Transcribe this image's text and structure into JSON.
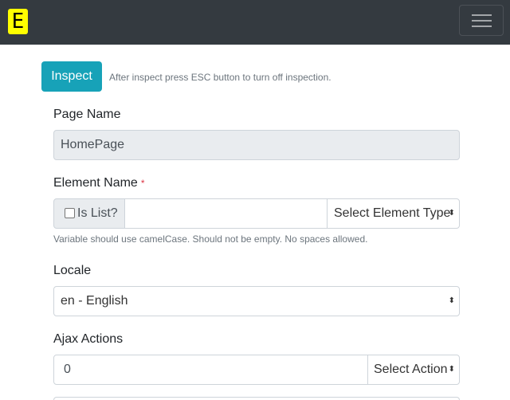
{
  "navbar": {
    "logo": "E",
    "toggler_icon": "hamburger-icon"
  },
  "inspect": {
    "button": "Inspect",
    "hint": "After inspect press ESC button to turn off inspection."
  },
  "page_name": {
    "label": "Page Name",
    "value": "HomePage"
  },
  "element_name": {
    "label": "Element Name",
    "required": "*",
    "is_list": "Is List?",
    "value": "",
    "type_select": "Select Element Type",
    "help": "Variable should use camelCase. Should not be empty. No spaces allowed."
  },
  "locale": {
    "label": "Locale",
    "value": "en - English"
  },
  "ajax": {
    "label": "Ajax Actions",
    "value": "0",
    "action_select": "Select Action"
  }
}
